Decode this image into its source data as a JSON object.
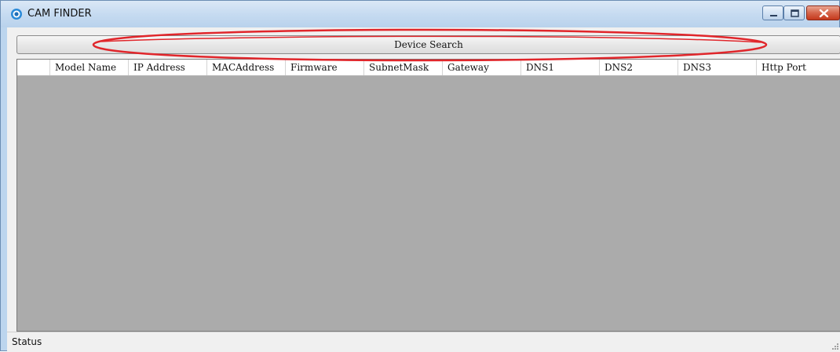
{
  "window": {
    "title": "CAM FINDER",
    "icon": "cam-finder-app-icon",
    "controls": [
      "minimize",
      "maximize",
      "close"
    ]
  },
  "toolbar": {
    "search_label": "Device Search"
  },
  "grid": {
    "columns": [
      "",
      "Model Name",
      "IP Address",
      "MACAddress",
      "Firmware",
      "SubnetMask",
      "Gateway",
      "DNS1",
      "DNS2",
      "DNS3",
      "Http Port"
    ],
    "rows": []
  },
  "statusbar": {
    "text": "Status"
  },
  "colors": {
    "annotation": "#e0262b",
    "grid_background": "#ababab",
    "title_bar": "#c6dbf1"
  }
}
